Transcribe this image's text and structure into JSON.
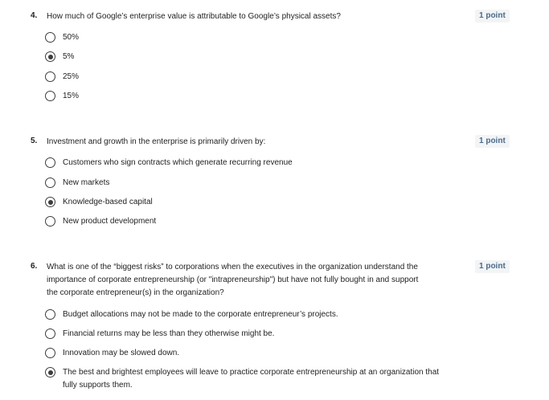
{
  "questions": [
    {
      "number": "4.",
      "text": "How much of Google’s enterprise value is attributable to Google’s physical assets?",
      "points": "1 point",
      "options": [
        {
          "label": "50%",
          "selected": false
        },
        {
          "label": "5%",
          "selected": true
        },
        {
          "label": "25%",
          "selected": false
        },
        {
          "label": "15%",
          "selected": false
        }
      ]
    },
    {
      "number": "5.",
      "text": "Investment and growth in the enterprise is primarily driven by:",
      "points": "1 point",
      "options": [
        {
          "label": "Customers who sign contracts which generate recurring revenue",
          "selected": false
        },
        {
          "label": "New markets",
          "selected": false
        },
        {
          "label": "Knowledge-based capital",
          "selected": true
        },
        {
          "label": "New product development",
          "selected": false
        }
      ]
    },
    {
      "number": "6.",
      "text": "What is one of the “biggest risks” to corporations when the executives in the organization understand the importance of corporate entrepreneurship (or \"intrapreneurship\") but have not fully bought in and support the corporate entrepreneur(s) in the organization?",
      "points": "1 point",
      "options": [
        {
          "label": "Budget allocations may not be made to the corporate entrepreneur’s projects.",
          "selected": false
        },
        {
          "label": "Financial returns may be less than they otherwise might be.",
          "selected": false
        },
        {
          "label": "Innovation may be slowed down.",
          "selected": false
        },
        {
          "label": "The best and brightest employees will leave to practice corporate entrepreneurship at an organization that fully supports them.",
          "selected": true
        }
      ]
    }
  ]
}
